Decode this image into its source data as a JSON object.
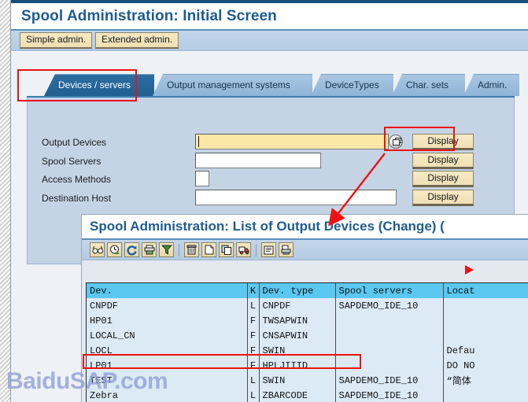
{
  "window1": {
    "title": "Spool Administration: Initial Screen",
    "toolbar": {
      "simple_admin": "Simple admin.",
      "extended_admin": "Extended admin."
    },
    "tabs": [
      {
        "label": "Devices / servers",
        "active": true
      },
      {
        "label": "Output management systems",
        "active": false
      },
      {
        "label": "DeviceTypes",
        "active": false
      },
      {
        "label": "Char. sets",
        "active": false
      },
      {
        "label": "Admin.",
        "active": false
      }
    ],
    "form": {
      "rows": [
        {
          "label": "Output Devices",
          "value": "",
          "button": "Display"
        },
        {
          "label": "Spool Servers",
          "value": "",
          "button": "Display"
        },
        {
          "label": "Access Methods",
          "value": "",
          "button": "Display"
        },
        {
          "label": "Destination Host",
          "value": "",
          "button": "Display"
        }
      ]
    }
  },
  "window2": {
    "title": "Spool Administration: List of Output Devices  (Change) (",
    "toolbar_icons": [
      "glasses-display-icon",
      "clock-history-icon",
      "refresh-icon",
      "print-icon",
      "filter-icon",
      "delete-trash-icon",
      "new-document-icon",
      "copy-icon",
      "transport-truck-icon",
      "list-detail-icon",
      "print-preview-icon"
    ],
    "table": {
      "columns": [
        "Dev.",
        "K",
        "Dev. type",
        "Spool servers",
        "Locat"
      ],
      "rows": [
        {
          "dev": "CNPDF",
          "k": "L",
          "type": "CNPDF",
          "spool": "SAPDEMO_IDE_10",
          "loc": "",
          "highlight": false
        },
        {
          "dev": "HP01",
          "k": "F",
          "type": "TWSAPWIN",
          "spool": "",
          "loc": "",
          "highlight": false
        },
        {
          "dev": "LOCAL_CN",
          "k": "F",
          "type": "CNSAPWIN",
          "spool": "",
          "loc": "",
          "highlight": false
        },
        {
          "dev": "LOCL",
          "k": "F",
          "type": "SWIN",
          "spool": "",
          "loc": "Defau",
          "highlight": false
        },
        {
          "dev": "LP01",
          "k": "F",
          "type": "HPLJIIID",
          "spool": "",
          "loc": "DO NO",
          "highlight": true
        },
        {
          "dev": "TEST",
          "k": "L",
          "type": "SWIN",
          "spool": "SAPDEMO_IDE_10",
          "loc": "“简体",
          "highlight": false
        },
        {
          "dev": "Zebra",
          "k": "L",
          "type": "ZBARCODE",
          "spool": "SAPDEMO_IDE_10",
          "loc": "",
          "highlight": false
        }
      ]
    }
  },
  "annotations": {
    "watermark": "BaiduSAP.com",
    "highlight_color": "#ee1111"
  }
}
